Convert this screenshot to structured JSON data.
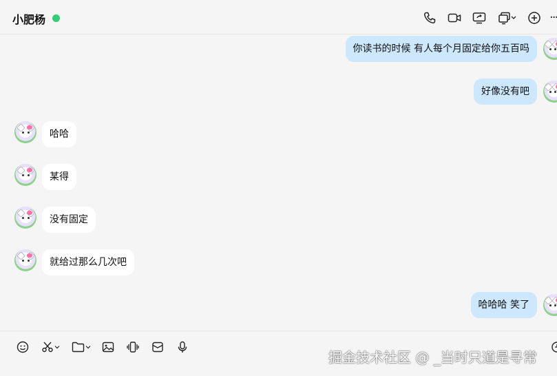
{
  "chat": {
    "title": "小肥杨",
    "online_status_color": "#33cc77"
  },
  "header_icons": [
    "phone-icon",
    "video-call-icon",
    "screen-share-icon",
    "multi-window-icon",
    "add-member-icon",
    "more-icon"
  ],
  "messages": [
    {
      "side": "out",
      "text": "你读书的时候 有人每个月固定给你五百吗"
    },
    {
      "side": "out",
      "text": "好像没有吧"
    },
    {
      "side": "in",
      "text": "哈哈"
    },
    {
      "side": "in",
      "text": "某得"
    },
    {
      "side": "in",
      "text": "没有固定"
    },
    {
      "side": "in",
      "text": "就给过那么几次吧"
    },
    {
      "side": "out",
      "text": "哈哈哈 笑了"
    }
  ],
  "toolbar_icons": [
    "emoji-icon",
    "screenshot-scissors-icon",
    "folder-icon",
    "image-icon",
    "shake-icon",
    "gift-box-icon",
    "microphone-icon",
    "history-icon"
  ],
  "watermark": "掘金技术社区 @ _当时只道是寻常",
  "colors": {
    "outgoing_bubble": "#cde7fc",
    "incoming_bubble": "#ffffff",
    "background": "#f5f5f5"
  }
}
